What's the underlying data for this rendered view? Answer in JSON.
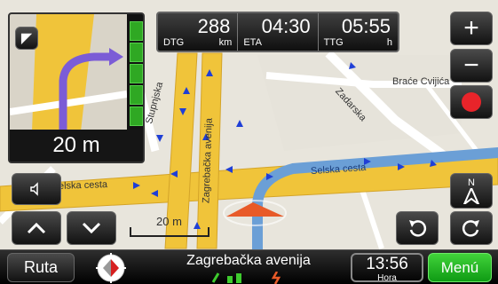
{
  "turn": {
    "distance": "20 m"
  },
  "info": {
    "dtg": {
      "value": "288",
      "label": "DTG",
      "unit": "km"
    },
    "eta": {
      "value": "04:30",
      "label": "ETA",
      "unit": ""
    },
    "ttg": {
      "value": "05:55",
      "label": "TTG",
      "unit": "h"
    }
  },
  "map": {
    "labels": {
      "braca": "Braće Cvijića",
      "zadarska": "Zadarska",
      "stupnjska": "Stupnjska",
      "zagrebacka_vertical": "Zagrebačka avenija",
      "selska_left": "elska cesta",
      "selska_right": "Selska cesta"
    },
    "scale": "20 m"
  },
  "controls": {
    "zoom_in": "+",
    "zoom_out": "−",
    "north": "N"
  },
  "bottom": {
    "route": "Ruta",
    "street": "Zagrebačka avenija",
    "time": "13:56",
    "time_label": "Hora",
    "menu": "Menú"
  },
  "colors": {
    "road_main": "#f0c43a",
    "road_secondary": "#ffffff",
    "route": "#6b9fd6",
    "record": "#e8242a",
    "menu_green": "#22b51e"
  }
}
